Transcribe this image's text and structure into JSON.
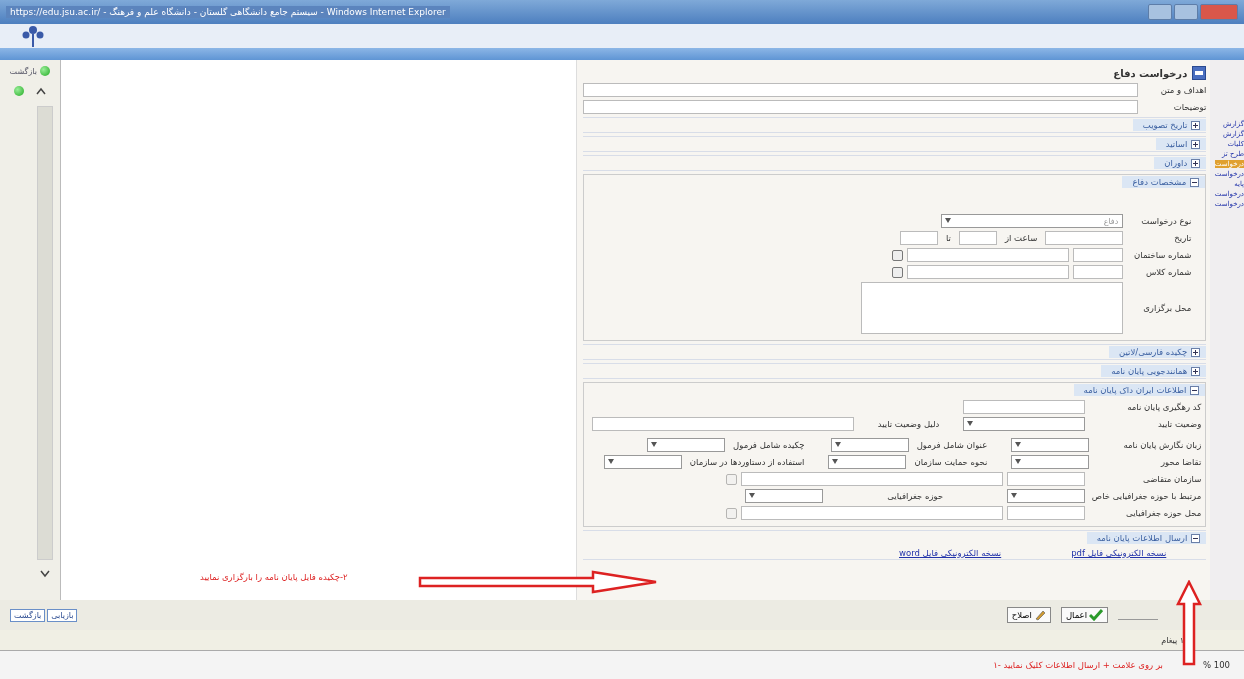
{
  "window": {
    "title": "https://edu.jsu.ac.ir/ - سیستم جامع دانشگاهی گلستان - دانشگاه علم و فرهنگ - Windows Internet Explorer"
  },
  "left_rail": {
    "label": "بازگشت"
  },
  "right_rail": {
    "items": [
      {
        "label": "گزارش",
        "selected": false
      },
      {
        "label": "گزارش",
        "selected": false
      },
      {
        "label": "کلیات",
        "selected": false
      },
      {
        "label": "طرح تز",
        "selected": false
      },
      {
        "label": "درخواست",
        "selected": true
      },
      {
        "label": "درخواست",
        "selected": false
      },
      {
        "label": "پایه",
        "selected": false
      },
      {
        "label": "درخواست",
        "selected": false
      },
      {
        "label": "درخواست",
        "selected": false
      }
    ]
  },
  "panel": {
    "title": "درخواست دفاع",
    "top_label": "اهداف و متن",
    "description_label": "توضیحات",
    "sections_before": [
      {
        "title": "تاریخ تصویب",
        "expanded": false
      },
      {
        "title": "اساتید",
        "expanded": false
      },
      {
        "title": "داوران",
        "expanded": false
      }
    ],
    "defense": {
      "title": "مشخصات دفاع",
      "expanded": true,
      "request_type_label": "نوع درخواست",
      "request_type_value": "دفاع",
      "date_label": "تاریخ",
      "time_from_label": "ساعت از",
      "time_to_label": "تا",
      "building_label": "شماره ساختمان",
      "room_label": "شماره کلاس",
      "place_label": "محل برگزاری"
    },
    "sections_middle": [
      {
        "title": "چکیده فارسی/لاتین",
        "expanded": false
      },
      {
        "title": "همانندجویی پایان نامه",
        "expanded": false
      }
    ],
    "irandoc": {
      "title": "اطلاعات ایران داک پایان نامه",
      "expanded": true,
      "tracking_label": "کد رهگیری پایان نامه",
      "status_label": "وضعیت تایید",
      "status_reason_label": "دلیل وضعیت تایید",
      "grid": [
        {
          "label": "زبان نگارش پایان نامه",
          "kind": "select"
        },
        {
          "label": "عنوان شامل فرمول",
          "kind": "select"
        },
        {
          "label": "چکیده شامل فرمول",
          "kind": "select"
        },
        {
          "label": "تقاضا محور",
          "kind": "select"
        },
        {
          "label": "نحوه حمایت سازمان",
          "kind": "select"
        },
        {
          "label": "استفاده از دستاوردها در سازمان",
          "kind": "select"
        }
      ],
      "org_label": "سازمان متقاضی",
      "geo_label": "مرتبط با حوزه جغرافیایی خاص",
      "geo_area_label": "حوزه جغرافیایی",
      "geo_place_label": "محل حوزه جغرافیایی"
    },
    "send": {
      "title": "ارسال اطلاعات پایان نامه",
      "expanded": true,
      "links": [
        "نسخه الکترونیکی فایل pdf",
        "نسخه الکترونیکی فایل word"
      ]
    }
  },
  "buttons": [
    {
      "label": "اعمال",
      "kind": "apply"
    },
    {
      "label": "اصلاح",
      "kind": "edit"
    }
  ],
  "left_buttons": [
    "بازیابی",
    "بازگشت"
  ],
  "message": "۱ پیغام",
  "annotations": {
    "upload": "۲-چکیده فایل پایان نامه را بارگزاری نمایید",
    "send": "۱- بر روی علامت + ارسال اطلاعات کلیک نمایید"
  },
  "status_bar": {
    "zoom": "% 100"
  }
}
